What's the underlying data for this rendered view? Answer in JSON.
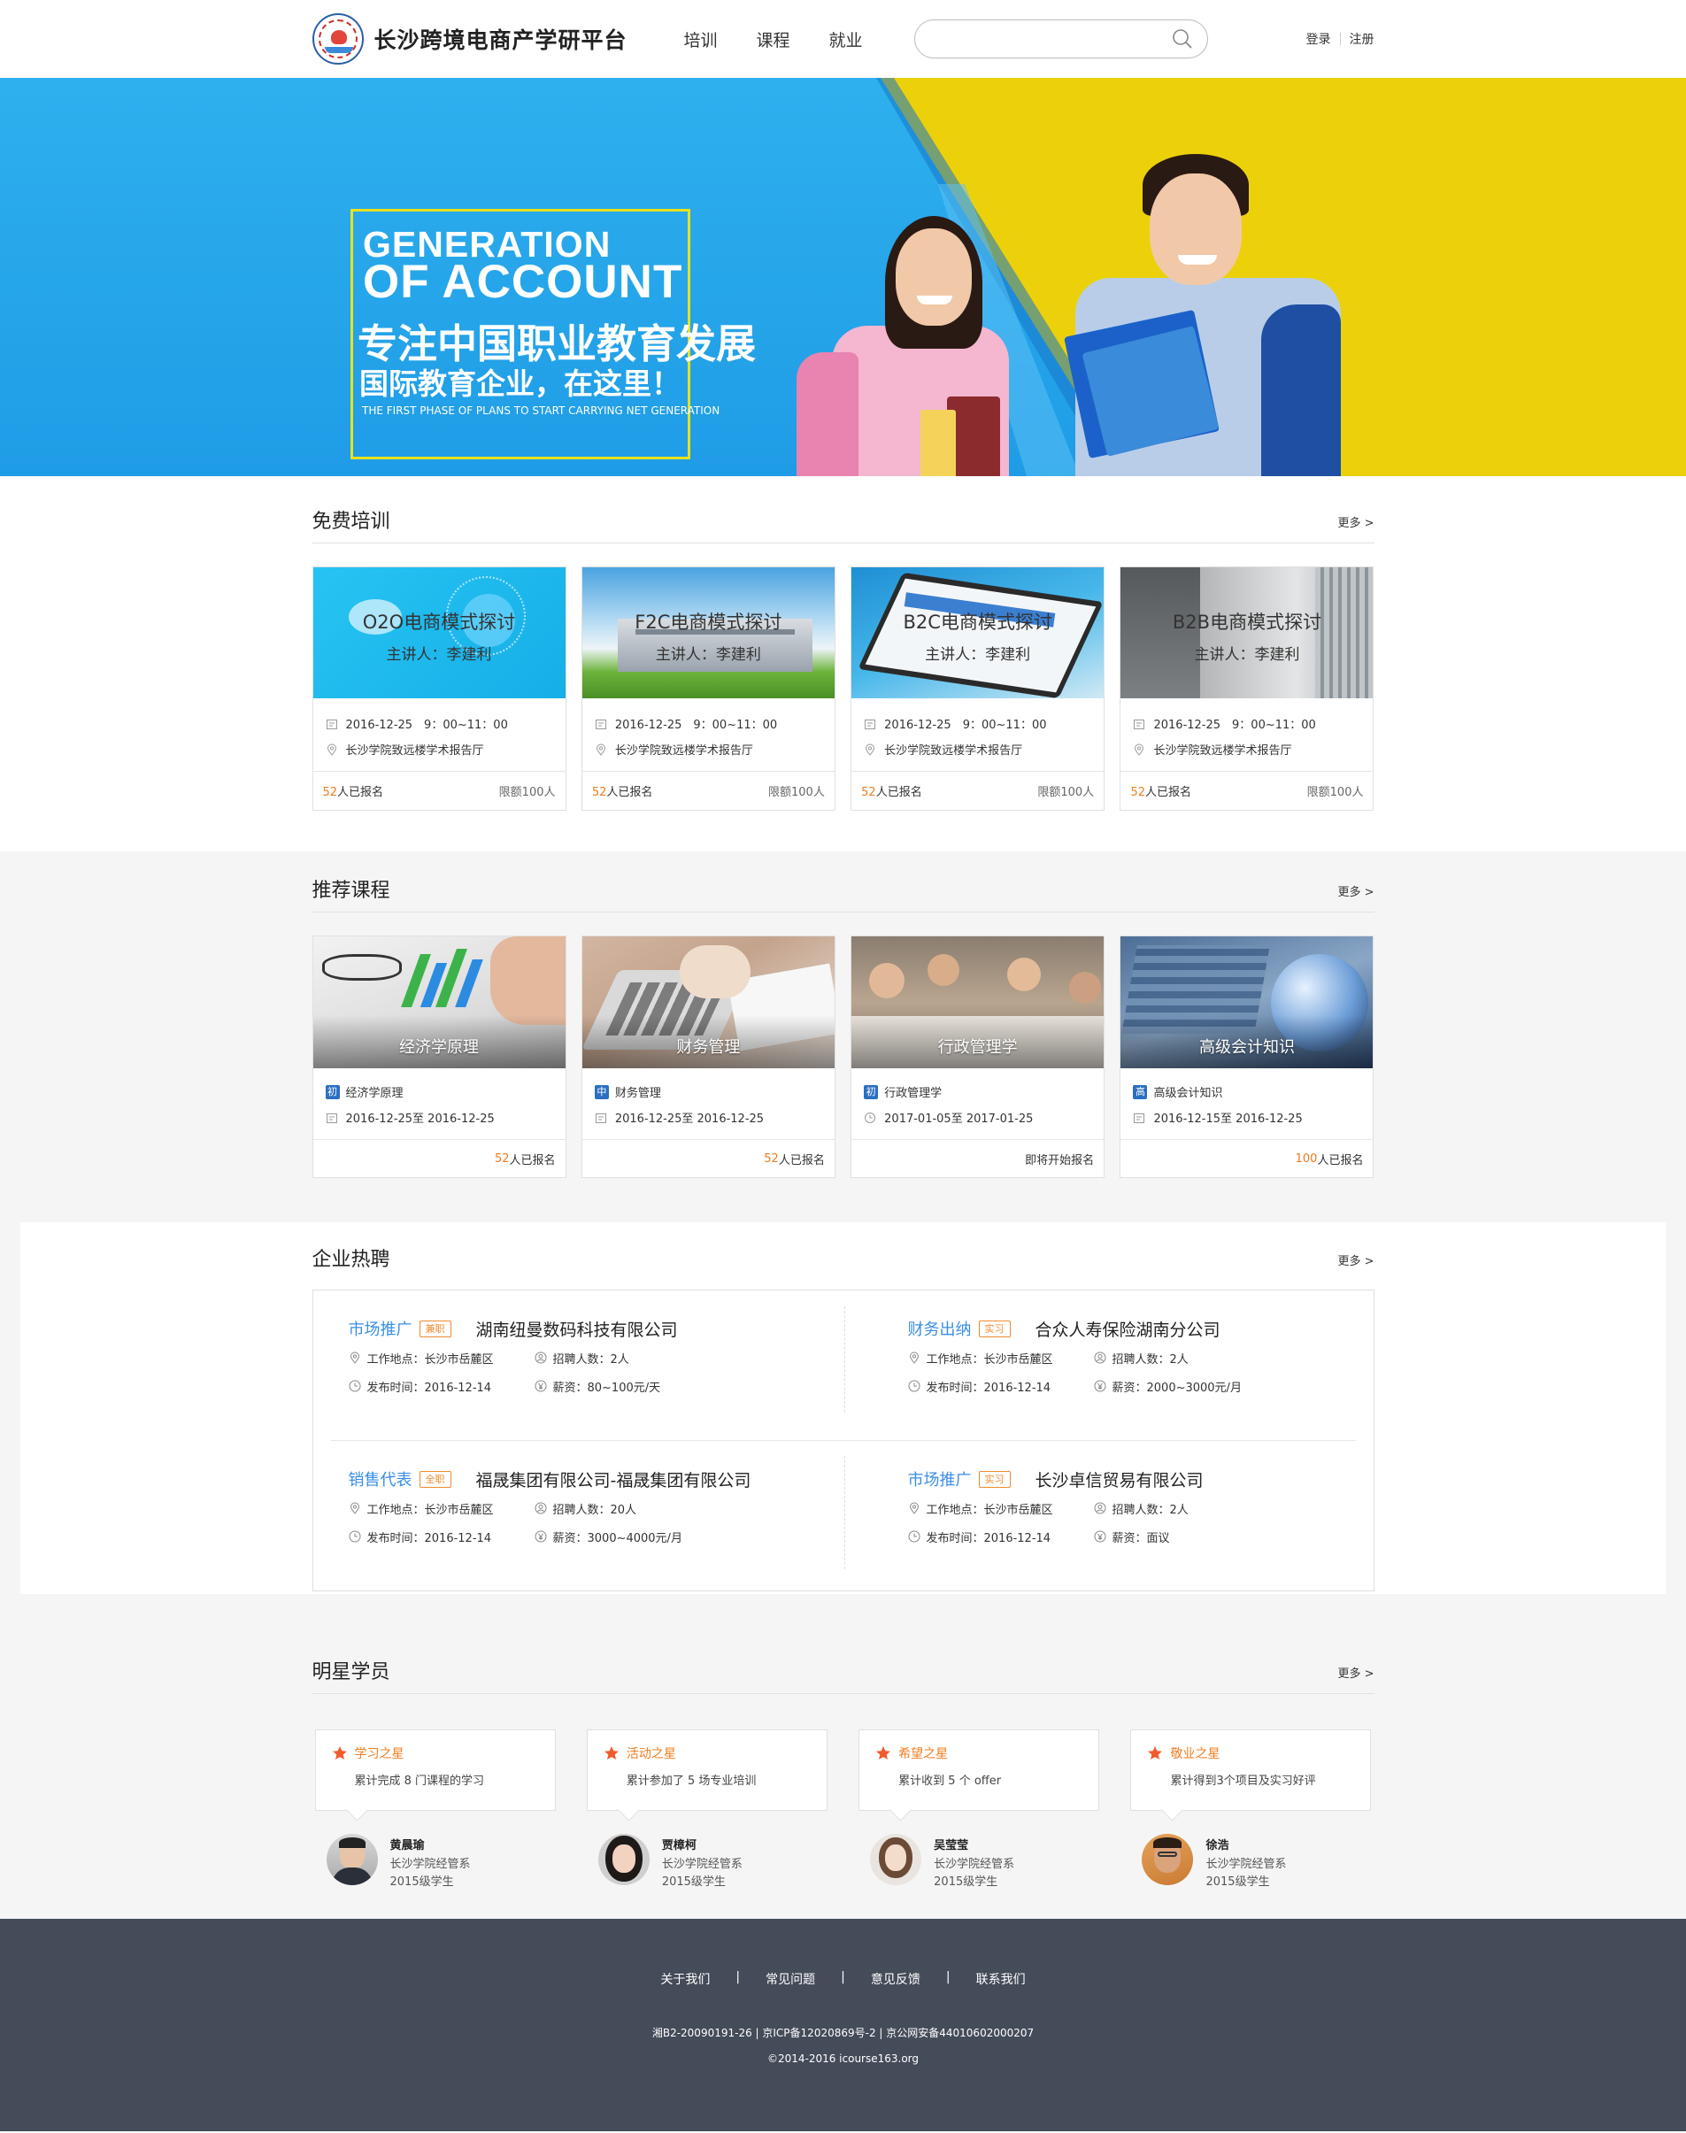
{
  "header": {
    "brand": "长沙跨境电商产学研平台",
    "nav": [
      "培训",
      "课程",
      "就业"
    ],
    "search_placeholder": "",
    "login": "登录",
    "register": "注册"
  },
  "banner": {
    "line1": "GENERATION",
    "line2": "OF ACCOUNT",
    "line3": "专注中国职业教育发展",
    "line4": "国际教育企业，在这里！",
    "line5": "THE FIRST PHASE OF PLANS TO START CARRYING NET GENERATION",
    "colors": {
      "blue": "#1fa3ea",
      "yellow": "#ecd10a",
      "frame": "#e8e21d"
    }
  },
  "training": {
    "title": "免费培训",
    "more": "更多 >",
    "items": [
      {
        "title": "O2O电商模式探讨",
        "host": "主讲人：李建利",
        "time": "2016-12-25　9：00~11：00",
        "place": "长沙学院致远楼学术报告厅",
        "count": "52",
        "signed": "人已报名",
        "limit": "限额100人"
      },
      {
        "title": "F2C电商模式探讨",
        "host": "主讲人：李建利",
        "time": "2016-12-25　9：00~11：00",
        "place": "长沙学院致远楼学术报告厅",
        "count": "52",
        "signed": "人已报名",
        "limit": "限额100人"
      },
      {
        "title": "B2C电商模式探讨",
        "host": "主讲人：李建利",
        "time": "2016-12-25　9：00~11：00",
        "place": "长沙学院致远楼学术报告厅",
        "count": "52",
        "signed": "人已报名",
        "limit": "限额100人"
      },
      {
        "title": "B2B电商模式探讨",
        "host": "主讲人：李建利",
        "time": "2016-12-25　9：00~11：00",
        "place": "长沙学院致远楼学术报告厅",
        "count": "52",
        "signed": "人已报名",
        "limit": "限额100人"
      }
    ]
  },
  "courses": {
    "title": "推荐课程",
    "more": "更多 >",
    "items": [
      {
        "caption": "经济学原理",
        "level": "初",
        "name": "经济学原理",
        "dates": "2016-12-25至 2016-12-25",
        "count": "52",
        "signed": "人已报名"
      },
      {
        "caption": "财务管理",
        "level": "中",
        "name": "财务管理",
        "dates": "2016-12-25至 2016-12-25",
        "count": "52",
        "signed": "人已报名"
      },
      {
        "caption": "行政管理学",
        "level": "初",
        "name": "行政管理学",
        "dates": "2017-01-05至 2017-01-25",
        "count": "",
        "signed": "即将开始报名"
      },
      {
        "caption": "高级会计知识",
        "level": "高",
        "name": "高级会计知识",
        "dates": "2016-12-15至 2016-12-25",
        "count": "100",
        "signed": "人已报名"
      }
    ]
  },
  "jobs": {
    "title": "企业热聘",
    "more": "更多 >",
    "items": [
      {
        "position": "市场推广",
        "tag": "兼职",
        "company": "湖南纽曼数码科技有限公司",
        "location": "工作地点：长沙市岳麓区",
        "hires": "招聘人数：2人",
        "date": "发布时间：2016-12-14",
        "salary": "薪资：80~100元/天"
      },
      {
        "position": "财务出纳",
        "tag": "实习",
        "company": "合众人寿保险湖南分公司",
        "location": "工作地点：长沙市岳麓区",
        "hires": "招聘人数：2人",
        "date": "发布时间：2016-12-14",
        "salary": "薪资：2000~3000元/月"
      },
      {
        "position": "销售代表",
        "tag": "全职",
        "company": "福晟集团有限公司-福晟集团有限公司",
        "location": "工作地点：长沙市岳麓区",
        "hires": "招聘人数：20人",
        "date": "发布时间：2016-12-14",
        "salary": "薪资：3000~4000元/月"
      },
      {
        "position": "市场推广",
        "tag": "实习",
        "company": "长沙卓信贸易有限公司",
        "location": "工作地点：长沙市岳麓区",
        "hires": "招聘人数：2人",
        "date": "发布时间：2016-12-14",
        "salary": "薪资：面议"
      }
    ]
  },
  "stars": {
    "title": "明星学员",
    "more": "更多 >",
    "items": [
      {
        "award": "学习之星",
        "desc": "累计完成 8 门课程的学习",
        "name": "黄晨瑜",
        "school": "长沙学院经管系",
        "grade": "2015级学生"
      },
      {
        "award": "活动之星",
        "desc": "累计参加了 5 场专业培训",
        "name": "贾樟柯",
        "school": "长沙学院经管系",
        "grade": "2015级学生"
      },
      {
        "award": "希望之星",
        "desc": "累计收到 5 个 offer",
        "name": "吴莹莹",
        "school": "长沙学院经管系",
        "grade": "2015级学生"
      },
      {
        "award": "敬业之星",
        "desc": "累计得到3个项目及实习好评",
        "name": "徐浩",
        "school": "长沙学院经管系",
        "grade": "2015级学生"
      }
    ]
  },
  "footer": {
    "links": [
      "关于我们",
      "常见问题",
      "意见反馈",
      "联系我们"
    ],
    "separator": "|",
    "license": "湘B2-20090191-26 | 京ICP备12020869号-2 | 京公网安备44010602000207",
    "copyright": "©2014-2016 icourse163.org"
  }
}
